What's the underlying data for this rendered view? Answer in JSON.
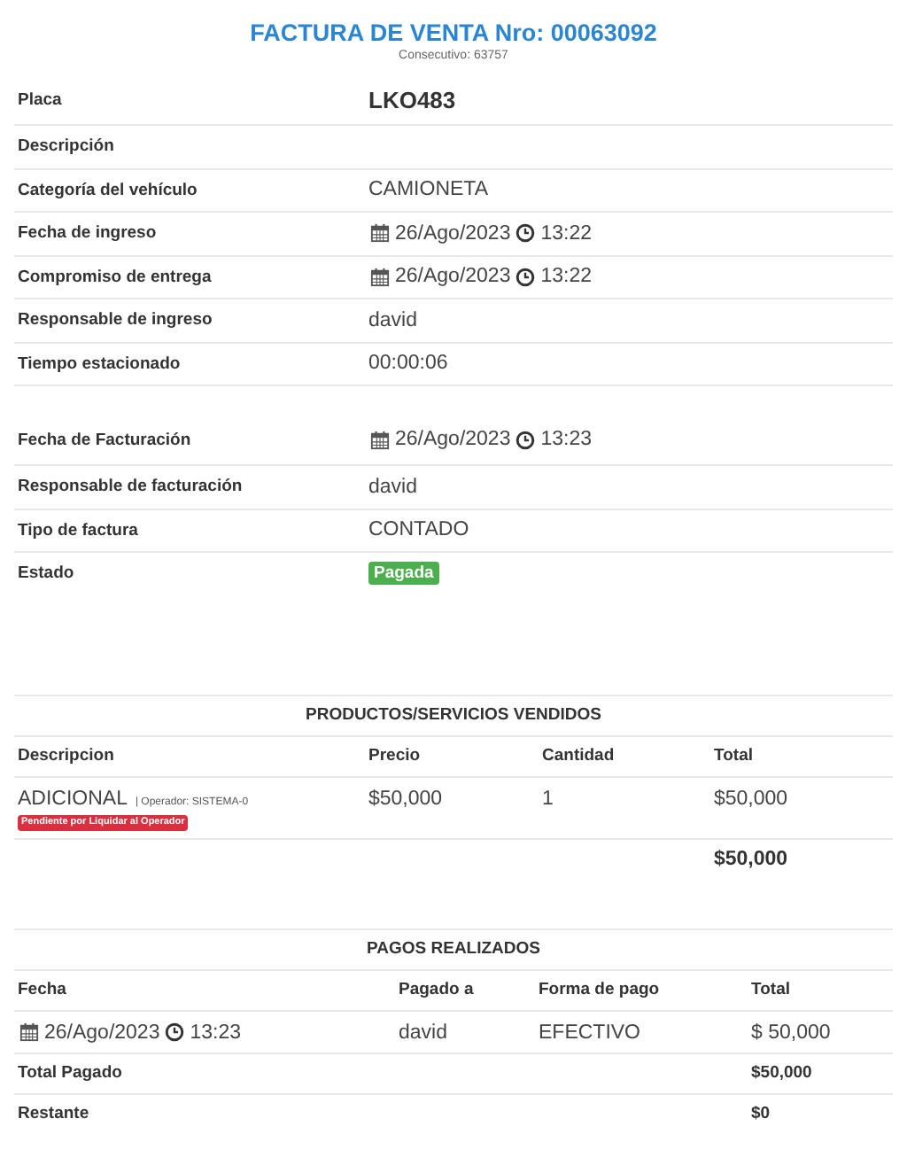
{
  "header": {
    "title": "FACTURA DE VENTA Nro: 00063092",
    "subtitle": "Consecutivo: 63757"
  },
  "detail_groups": [
    [
      {
        "label": "Placa",
        "kind": "strong",
        "value": "LKO483"
      },
      {
        "label": "Descripción",
        "kind": "empty"
      },
      {
        "label": "Categoría del vehículo",
        "kind": "text",
        "value": "CAMIONETA"
      },
      {
        "label": "Fecha de ingreso",
        "kind": "datetime",
        "date": "26/Ago/2023",
        "time": "13:22"
      },
      {
        "label": "Compromiso de entrega",
        "kind": "datetime",
        "date": "26/Ago/2023",
        "time": "13:22"
      },
      {
        "label": "Responsable de ingreso",
        "kind": "text",
        "value": "david"
      },
      {
        "label": "Tiempo estacionado",
        "kind": "text",
        "value": "00:00:06"
      }
    ],
    [
      {
        "label": "Fecha de Facturación",
        "kind": "datetime",
        "date": "26/Ago/2023",
        "time": "13:23"
      },
      {
        "label": "Responsable de facturación",
        "kind": "text",
        "value": "david"
      },
      {
        "label": "Tipo de factura",
        "kind": "text",
        "value": "CONTADO"
      },
      {
        "label": "Estado",
        "kind": "badge",
        "value": "Pagada"
      }
    ]
  ],
  "products": {
    "title": "PRODUCTOS/SERVICIOS VENDIDOS",
    "columns": [
      "Descripcion",
      "Precio",
      "Cantidad",
      "Total"
    ],
    "rows": [
      {
        "description": "ADICIONAL",
        "operator": "| Operador: SISTEMA-0",
        "badge": "Pendiente por Liquidar al Operador",
        "price": "$50,000",
        "quantity": "1",
        "total": "$50,000"
      }
    ],
    "grand_total": "$50,000"
  },
  "payments": {
    "title": "PAGOS REALIZADOS",
    "columns": [
      "Fecha",
      "Pagado a",
      "Forma de pago",
      "Total"
    ],
    "rows": [
      {
        "date": "26/Ago/2023",
        "time": "13:23",
        "paid_to": "david",
        "method": "EFECTIVO",
        "total": "$ 50,000"
      }
    ],
    "summary": [
      {
        "label": "Total Pagado",
        "value": "$50,000"
      },
      {
        "label": "Restante",
        "value": "$0"
      }
    ]
  }
}
